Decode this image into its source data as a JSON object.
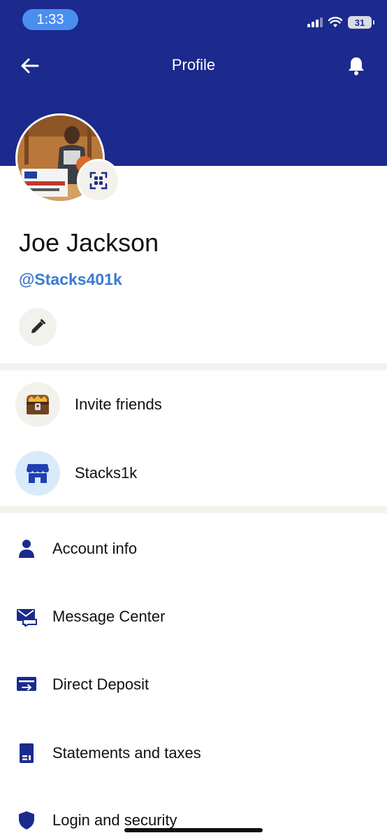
{
  "status_bar": {
    "time": "1:33",
    "battery": "31",
    "icons": [
      "signal-icon",
      "wifi-icon",
      "battery-icon"
    ]
  },
  "nav": {
    "title": "Profile",
    "back_icon": "back-arrow-icon",
    "bell_icon": "bell-icon"
  },
  "profile": {
    "name": "Joe Jackson",
    "handle": "@Stacks401k",
    "avatar_icon": "profile-photo",
    "qr_icon": "qr-scan-icon",
    "edit_icon": "pencil-icon"
  },
  "features": [
    {
      "label": "Invite friends",
      "icon": "treasure-chest-icon"
    },
    {
      "label": "Stacks1k",
      "icon": "storefront-icon"
    }
  ],
  "menu": [
    {
      "label": "Account info",
      "icon": "person-icon"
    },
    {
      "label": "Message Center",
      "icon": "message-icon"
    },
    {
      "label": "Direct Deposit",
      "icon": "direct-deposit-icon"
    },
    {
      "label": "Statements and taxes",
      "icon": "document-icon"
    },
    {
      "label": "Login and security",
      "icon": "shield-icon"
    }
  ],
  "colors": {
    "header": "#1b2a8c",
    "accent": "#3c7bd0",
    "icon": "#1b2a8c",
    "divider": "#f4f2ec"
  }
}
